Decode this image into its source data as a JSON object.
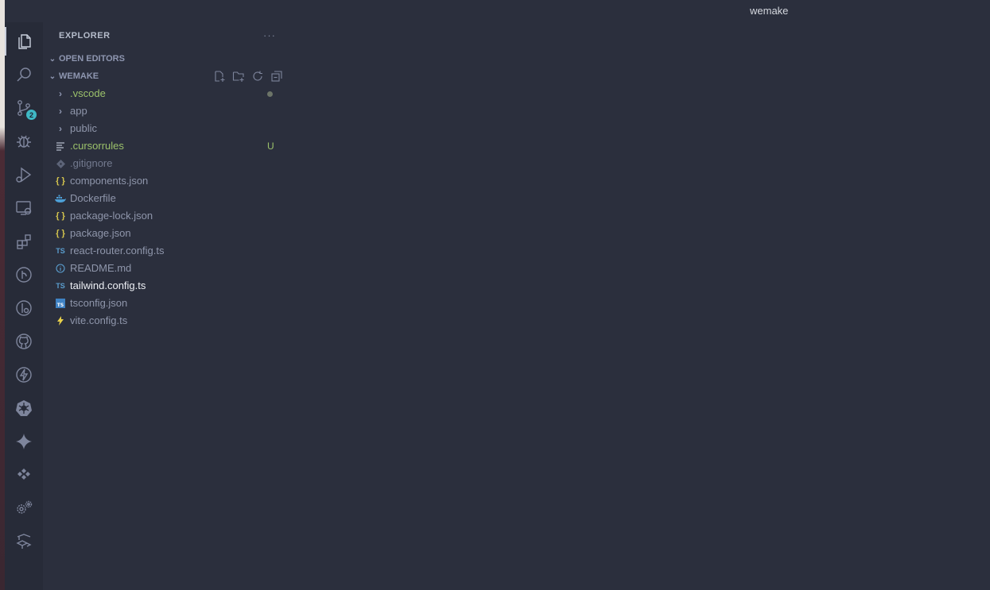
{
  "window": {
    "title": "wemake"
  },
  "activity_bar": {
    "items": [
      {
        "icon": "explorer-icon",
        "active": true
      },
      {
        "icon": "search-icon"
      },
      {
        "icon": "source-control-icon",
        "badge": "2"
      },
      {
        "icon": "debug-icon"
      },
      {
        "icon": "run-debug-icon"
      },
      {
        "icon": "remote-explorer-icon"
      },
      {
        "icon": "extensions-icon"
      },
      {
        "icon": "git-graph-icon"
      },
      {
        "icon": "git-lens-icon"
      },
      {
        "icon": "github-icon"
      },
      {
        "icon": "lightning-icon"
      },
      {
        "icon": "kubernetes-icon"
      },
      {
        "icon": "sparkle-icon"
      },
      {
        "icon": "diamonds-icon"
      },
      {
        "icon": "settings-gears-icon"
      },
      {
        "icon": "deploy-icon"
      }
    ]
  },
  "sidebar": {
    "title": "EXPLORER",
    "more_label": "···",
    "open_editors_label": "OPEN EDITORS",
    "workspace_label": "WEMAKE",
    "files": [
      {
        "name": ".vscode",
        "type": "folder",
        "color": "#9cc26b",
        "status": "dot"
      },
      {
        "name": "app",
        "type": "folder",
        "color": "#8f96ab"
      },
      {
        "name": "public",
        "type": "folder",
        "color": "#8f96ab"
      },
      {
        "name": ".cursorrules",
        "type": "lines",
        "color": "#9cc26b",
        "status": "U"
      },
      {
        "name": ".gitignore",
        "type": "git",
        "color": "#737a8f"
      },
      {
        "name": "components.json",
        "type": "json",
        "color": "#8f96ab"
      },
      {
        "name": "Dockerfile",
        "type": "docker",
        "color": "#8f96ab"
      },
      {
        "name": "package-lock.json",
        "type": "json",
        "color": "#8f96ab"
      },
      {
        "name": "package.json",
        "type": "json",
        "color": "#8f96ab"
      },
      {
        "name": "react-router.config.ts",
        "type": "ts",
        "color": "#8f96ab"
      },
      {
        "name": "README.md",
        "type": "info",
        "color": "#8f96ab"
      },
      {
        "name": "tailwind.config.ts",
        "type": "ts",
        "color": "#eef0f5"
      },
      {
        "name": "tsconfig.json",
        "type": "tsconfig",
        "color": "#8f96ab"
      },
      {
        "name": "vite.config.ts",
        "type": "vite",
        "color": "#8f96ab"
      }
    ]
  },
  "colors": {
    "editor_bg": "#2b2f3d",
    "activity_bg": "#272b38",
    "modified": "#9cc26b",
    "badge": "#3fb8c4",
    "json_icon": "#d6c64e",
    "ts_icon": "#5b9fd0"
  }
}
